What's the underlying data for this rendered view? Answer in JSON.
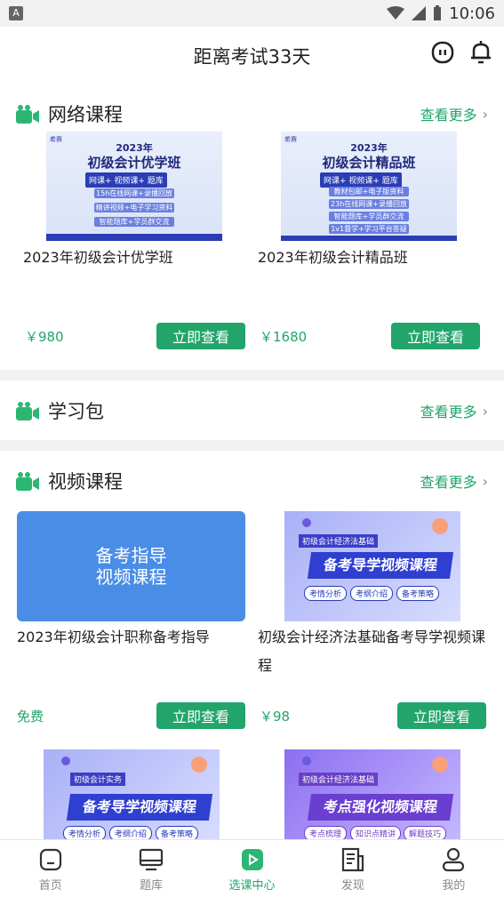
{
  "status": {
    "time": "10:06"
  },
  "header": {
    "title": "距离考试33天"
  },
  "sections": {
    "online": {
      "title": "网络课程",
      "more": "查看更多"
    },
    "package": {
      "title": "学习包",
      "more": "查看更多"
    },
    "video": {
      "title": "视频课程",
      "more": "查看更多"
    }
  },
  "online_courses": [
    {
      "title": "2023年初级会计优学班",
      "price": "￥980",
      "button": "立即查看",
      "thumb": {
        "brand": "希赛",
        "year": "2023年",
        "name": "初级会计优学班",
        "features": "网课+ 视频课+ 题库",
        "lines": [
          "15h在线网课+录播回放",
          "精讲视频+电子学习资料",
          "智能题库+学员群交流"
        ]
      }
    },
    {
      "title": "2023年初级会计精品班",
      "price": "￥1680",
      "button": "立即查看",
      "thumb": {
        "brand": "希赛",
        "year": "2023年",
        "name": "初级会计精品班",
        "features": "网课+ 视频课+ 题库",
        "lines": [
          "教材包邮+电子版资料",
          "23h在线网课+录播回放",
          "智能题库+学员群交流",
          "1v1督学+学习平台答疑"
        ]
      }
    }
  ],
  "video_courses": [
    {
      "title": "2023年初级会计职称备考指导",
      "price": "免费",
      "button": "立即查看",
      "thumb_text": [
        "备考指导",
        "视频课程"
      ]
    },
    {
      "title": "初级会计经济法基础备考导学视频课程",
      "price": "￥98",
      "button": "立即查看",
      "thumb": {
        "subject": "初级会计经济法基础",
        "headline": "备考导学视频课程",
        "pills": [
          "考情分析",
          "考纲介绍",
          "备考策略"
        ]
      }
    },
    {
      "thumb": {
        "subject": "初级会计实务",
        "headline": "备考导学视频课程",
        "pills": [
          "考情分析",
          "考纲介绍",
          "备考策略"
        ]
      }
    },
    {
      "thumb": {
        "subject": "初级会计经济法基础",
        "headline": "考点强化视频课程",
        "pills": [
          "考点梳理",
          "知识点精讲",
          "解题技巧"
        ]
      }
    }
  ],
  "tabs": [
    {
      "label": "首页",
      "icon": "home-icon"
    },
    {
      "label": "题库",
      "icon": "monitor-icon"
    },
    {
      "label": "选课中心",
      "icon": "play-icon",
      "active": true
    },
    {
      "label": "发现",
      "icon": "news-icon"
    },
    {
      "label": "我的",
      "icon": "person-icon"
    }
  ],
  "colors": {
    "accent": "#21a56b",
    "banner_blue": "#2a3db5"
  }
}
